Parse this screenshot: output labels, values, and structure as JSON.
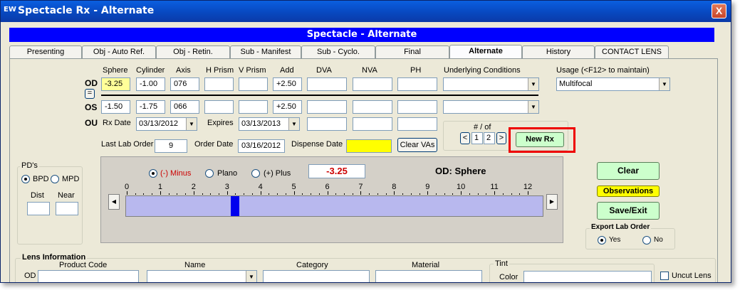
{
  "window": {
    "logo": "EW",
    "title": "Spectacle Rx - Alternate",
    "close": "X"
  },
  "banner": "Spectacle - Alternate",
  "tabs": [
    {
      "label": "Presenting"
    },
    {
      "label": "Obj - Auto Ref."
    },
    {
      "label": "Obj - Retin."
    },
    {
      "label": "Sub - Manifest"
    },
    {
      "label": "Sub - Cyclo."
    },
    {
      "label": "Final"
    },
    {
      "label": "Alternate"
    },
    {
      "label": "History"
    },
    {
      "label": "CONTACT LENS"
    }
  ],
  "rx": {
    "headers": {
      "sphere": "Sphere",
      "cylinder": "Cylinder",
      "axis": "Axis",
      "hprism": "H Prism",
      "vprism": "V Prism",
      "add": "Add",
      "dva": "DVA",
      "nva": "NVA",
      "ph": "PH",
      "underlying": "Underlying Conditions",
      "usage": "Usage (<F12> to maintain)"
    },
    "od": {
      "label": "OD",
      "sphere": "-3.25",
      "cylinder": "-1.00",
      "axis": "076",
      "add": "+2.50"
    },
    "equal_button": "=",
    "os": {
      "label": "OS",
      "sphere": "-1.50",
      "cylinder": "-1.75",
      "axis": "066",
      "add": "+2.50"
    },
    "ou": {
      "label": "OU"
    },
    "usage_value": "Multifocal",
    "rx_date_label": "Rx Date",
    "rx_date": "03/13/2012",
    "expires_label": "Expires",
    "expires": "03/13/2013",
    "last_lab_order_label": "Last Lab Order",
    "last_lab_order": "9",
    "order_date_label": "Order Date",
    "order_date": "03/16/2012",
    "dispense_date_label": "Dispense Date",
    "dispense_date": "",
    "clear_vas": "Clear VAs"
  },
  "pager": {
    "label": "# / of",
    "current": "1",
    "total": "2",
    "prev": "<",
    "next": ">",
    "new_rx": "New Rx"
  },
  "pd": {
    "title": "PD's",
    "bpd": "BPD",
    "mpd": "MPD",
    "selected": "BPD",
    "dist": "Dist",
    "near": "Near"
  },
  "slider": {
    "minus": "(-) Minus",
    "plano": "Plano",
    "plus": "(+) Plus",
    "selected": "(-) Minus",
    "value": "-3.25",
    "field_label": "OD: Sphere",
    "ticks": [
      "0",
      "1",
      "2",
      "3",
      "4",
      "5",
      "6",
      "7",
      "8",
      "9",
      "10",
      "11",
      "12"
    ],
    "thumb_value": 3.25,
    "left_arrow": "◀",
    "right_arrow": "▶"
  },
  "actions": {
    "clear": "Clear",
    "observations": "Observations",
    "save_exit": "Save/Exit"
  },
  "export": {
    "title": "Export Lab Order",
    "yes": "Yes",
    "no": "No",
    "selected": "Yes"
  },
  "lens": {
    "title": "Lens Information",
    "product_code": "Product Code",
    "name": "Name",
    "category": "Category",
    "material": "Material",
    "tint": "Tint",
    "color": "Color",
    "od": "OD",
    "uncut": "Uncut Lens"
  },
  "colors": {
    "banner": "#0000ff",
    "highlight": "#ff0000",
    "value_red": "#cc0000",
    "green_button": "#ccffcc",
    "dispense_yellow": "#ffff00"
  }
}
